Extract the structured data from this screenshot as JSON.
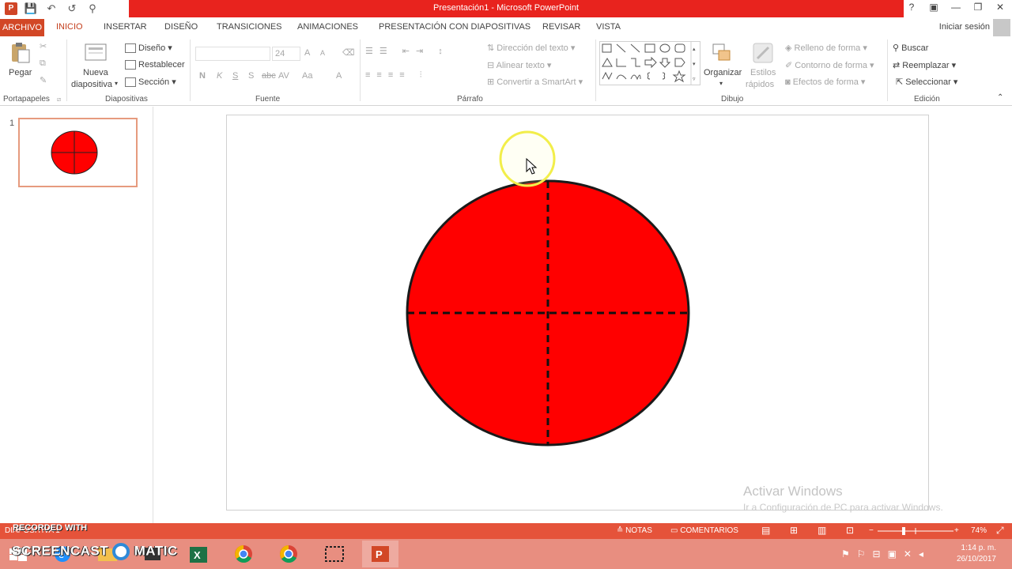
{
  "window": {
    "title": "Presentación1 - Microsoft PowerPoint",
    "controls": [
      "?",
      "▣",
      "—",
      "❐",
      "✕"
    ]
  },
  "qat": {
    "logo": "P",
    "save": "💾",
    "undo": "↶",
    "redo": "↺",
    "customize": "⚲"
  },
  "tabs": {
    "file": "ARCHIVO",
    "items": [
      "INICIO",
      "INSERTAR",
      "DISEÑO",
      "TRANSICIONES",
      "ANIMACIONES",
      "PRESENTACIÓN CON DIAPOSITIVAS",
      "REVISAR",
      "VISTA"
    ],
    "active": "INICIO",
    "signin": "Iniciar sesión"
  },
  "ribbon": {
    "clipboard": {
      "paste": "Pegar",
      "group": "Portapapeles"
    },
    "slides": {
      "new_slide_1": "Nueva",
      "new_slide_2": "diapositiva",
      "layout": "Diseño",
      "reset": "Restablecer",
      "section": "Sección",
      "group": "Diapositivas"
    },
    "font": {
      "size": "24",
      "bold": "N",
      "italic": "K",
      "underline": "S",
      "shadow": "S",
      "strike": "abc",
      "spacing": "AV",
      "case": "Aa",
      "color": "A",
      "grow": "A",
      "shrink": "A",
      "group": "Fuente"
    },
    "paragraph": {
      "text_direction": "Dirección del texto",
      "align_text": "Alinear texto",
      "smartart": "Convertir a SmartArt",
      "group": "Párrafo"
    },
    "drawing": {
      "arrange": "Organizar",
      "quick_styles_1": "Estilos",
      "quick_styles_2": "rápidos",
      "fill": "Relleno de forma",
      "outline": "Contorno de forma",
      "effects": "Efectos de forma",
      "group": "Dibujo"
    },
    "editing": {
      "find": "Buscar",
      "replace": "Reemplazar",
      "select": "Seleccionar",
      "group": "Edición"
    }
  },
  "thumbnails": [
    {
      "number": "1"
    }
  ],
  "watermark": {
    "line1": "Activar Windows",
    "line2": "Ir a Configuración de PC para activar Windows."
  },
  "statusbar": {
    "slide_info": "DIAPOSITIVA 1",
    "notes": "NOTAS",
    "comments": "COMENTARIOS",
    "zoom": "74%"
  },
  "recording": {
    "line1": "RECORDED WITH",
    "line2": "SCREENCAST",
    "line3": "MATIC"
  },
  "taskbar": {
    "time": "1:14 p. m.",
    "date": "26/10/2017"
  },
  "colors": {
    "accent": "#d24726",
    "title_red": "#e8231e",
    "status_orange": "#e5533a",
    "shape_fill": "#ff0000"
  }
}
